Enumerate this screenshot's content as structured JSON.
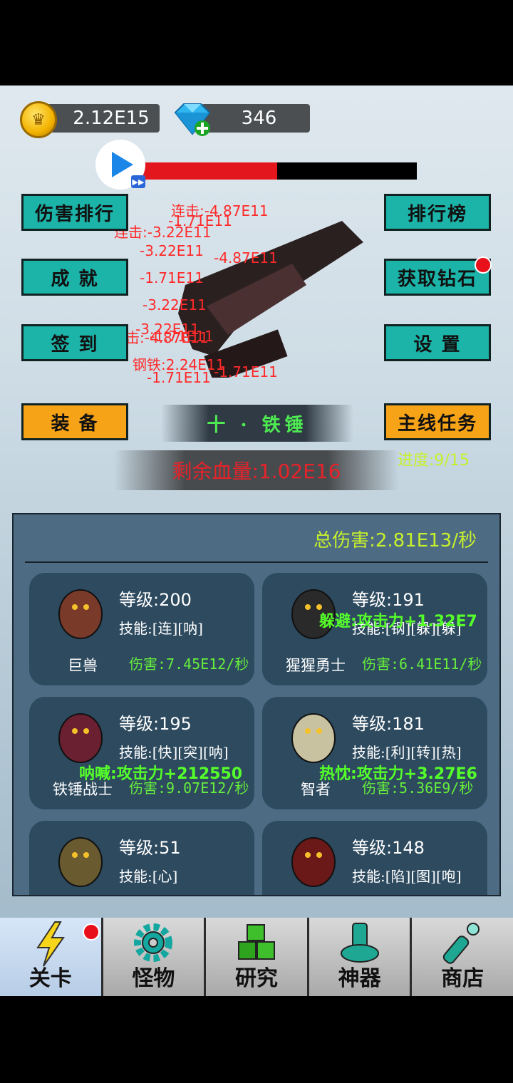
{
  "currency": {
    "gold": "2.12E15",
    "diamonds": "346"
  },
  "boss_hp_fraction": 0.49,
  "side_buttons": {
    "damage_rank": "伤害排行",
    "leaderboard": "排行榜",
    "achievement": "成 就",
    "get_diamonds": "获取钻石",
    "sign_in": "签 到",
    "settings": "设 置",
    "equipment": "装 备",
    "main_quest": "主线任务"
  },
  "stage": {
    "title": "十 · 铁锤",
    "hp_label": "剩余血量:1.02E16",
    "progress_label": "进度:",
    "progress_value": "9/15"
  },
  "damage_numbers": [
    "连击:-4.87E11",
    "-1.71E11",
    "连击:-3.22E11",
    "-3.22E11",
    "-4.87E11",
    "-1.71E11",
    "-3.22E11",
    "-1.71E11",
    "连击:-4.87E11",
    "-3.22E11",
    "钢铁:2.24E11",
    "-1.71E11",
    "-1.71E11"
  ],
  "panel": {
    "total_damage": "总伤害:2.81E13/秒",
    "monsters": [
      {
        "name": "巨兽",
        "level": "等级:200",
        "skills": "技能:[连][呐]",
        "dps": "伤害:7.45E12/秒",
        "buff": ""
      },
      {
        "name": "猩猩勇士",
        "level": "等级:191",
        "skills": "技能:[钢][躲][躲]",
        "dps": "伤害:6.41E11/秒",
        "buff": "躲避:攻击力+1.32E7"
      },
      {
        "name": "铁锤战士",
        "level": "等级:195",
        "skills": "技能:[快][突][呐]",
        "dps": "伤害:9.07E12/秒",
        "buff": "呐喊:攻击力+212550"
      },
      {
        "name": "智者",
        "level": "等级:181",
        "skills": "技能:[利][转][热]",
        "dps": "伤害:5.36E9/秒",
        "buff": "热忱:攻击力+3.27E6"
      },
      {
        "name": "",
        "level": "等级:51",
        "skills": "技能:[心]",
        "dps": "",
        "buff": ""
      },
      {
        "name": "",
        "level": "等级:148",
        "skills": "技能:[陷][图][咆]",
        "dps": "",
        "buff": ""
      }
    ]
  },
  "nav": [
    {
      "label": "关卡",
      "icon": "lightning-icon"
    },
    {
      "label": "怪物",
      "icon": "gear-icon"
    },
    {
      "label": "研究",
      "icon": "cubes-icon"
    },
    {
      "label": "神器",
      "icon": "bell-artifact-icon"
    },
    {
      "label": "商店",
      "icon": "bottle-icon"
    }
  ],
  "colors": {
    "teal_button": "#1cb3a8",
    "orange_button": "#f7a318",
    "hp_red": "#e2161c",
    "green_text": "#66ee3c"
  }
}
